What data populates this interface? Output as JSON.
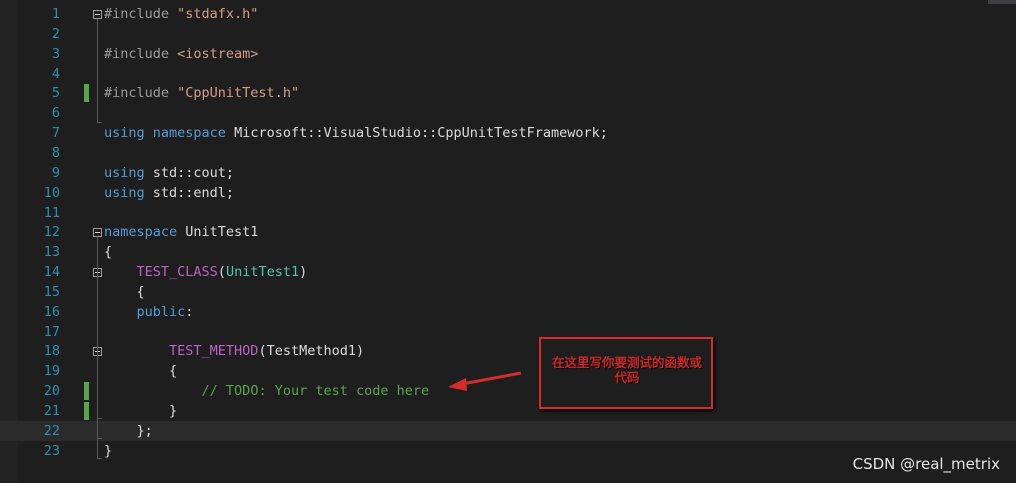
{
  "editor": {
    "lines": [
      {
        "number": "1",
        "fold": true,
        "changed": false,
        "tokens": [
          {
            "t": "#include ",
            "c": "pp"
          },
          {
            "t": "\"stdafx.h\"",
            "c": "str"
          }
        ]
      },
      {
        "number": "2",
        "fold": false,
        "changed": false,
        "tokens": []
      },
      {
        "number": "3",
        "fold": false,
        "changed": false,
        "tokens": [
          {
            "t": "#include ",
            "c": "pp"
          },
          {
            "t": "<iostream>",
            "c": "str"
          }
        ]
      },
      {
        "number": "4",
        "fold": false,
        "changed": false,
        "tokens": []
      },
      {
        "number": "5",
        "fold": false,
        "changed": true,
        "tokens": [
          {
            "t": "#include ",
            "c": "pp"
          },
          {
            "t": "\"CppUnitTest.h\"",
            "c": "str"
          }
        ]
      },
      {
        "number": "6",
        "fold": false,
        "changed": false,
        "tokens": []
      },
      {
        "number": "7",
        "fold": false,
        "changed": false,
        "tokens": [
          {
            "t": "using ",
            "c": "kw"
          },
          {
            "t": "namespace ",
            "c": "kw"
          },
          {
            "t": "Microsoft::VisualStudio::CppUnitTestFramework;",
            "c": "id"
          }
        ]
      },
      {
        "number": "8",
        "fold": false,
        "changed": false,
        "tokens": []
      },
      {
        "number": "9",
        "fold": false,
        "changed": false,
        "tokens": [
          {
            "t": "using ",
            "c": "kw"
          },
          {
            "t": "std::cout;",
            "c": "id"
          }
        ]
      },
      {
        "number": "10",
        "fold": false,
        "changed": false,
        "tokens": [
          {
            "t": "using ",
            "c": "kw"
          },
          {
            "t": "std::endl;",
            "c": "id"
          }
        ]
      },
      {
        "number": "11",
        "fold": false,
        "changed": false,
        "tokens": []
      },
      {
        "number": "12",
        "fold": true,
        "changed": false,
        "tokens": [
          {
            "t": "namespace ",
            "c": "kw"
          },
          {
            "t": "UnitTest1",
            "c": "id"
          }
        ]
      },
      {
        "number": "13",
        "fold": false,
        "changed": false,
        "tokens": [
          {
            "t": "{",
            "c": "id"
          }
        ]
      },
      {
        "number": "14",
        "fold": true,
        "changed": false,
        "tokens": [
          {
            "t": "    ",
            "c": "id"
          },
          {
            "t": "TEST_CLASS",
            "c": "mac"
          },
          {
            "t": "(",
            "c": "id"
          },
          {
            "t": "UnitTest1",
            "c": "typ"
          },
          {
            "t": ")",
            "c": "id"
          }
        ]
      },
      {
        "number": "15",
        "fold": false,
        "changed": false,
        "tokens": [
          {
            "t": "    {",
            "c": "id"
          }
        ]
      },
      {
        "number": "16",
        "fold": false,
        "changed": false,
        "tokens": [
          {
            "t": "    ",
            "c": "id"
          },
          {
            "t": "public",
            "c": "kw"
          },
          {
            "t": ":",
            "c": "id"
          }
        ]
      },
      {
        "number": "17",
        "fold": false,
        "changed": false,
        "tokens": []
      },
      {
        "number": "18",
        "fold": true,
        "changed": false,
        "tokens": [
          {
            "t": "        ",
            "c": "id"
          },
          {
            "t": "TEST_METHOD",
            "c": "mac"
          },
          {
            "t": "(TestMethod1)",
            "c": "id"
          }
        ]
      },
      {
        "number": "19",
        "fold": false,
        "changed": false,
        "tokens": [
          {
            "t": "        {",
            "c": "id"
          }
        ]
      },
      {
        "number": "20",
        "fold": false,
        "changed": true,
        "tokens": [
          {
            "t": "            ",
            "c": "id"
          },
          {
            "t": "// TODO: Your test code here",
            "c": "cmt"
          }
        ]
      },
      {
        "number": "21",
        "fold": false,
        "changed": true,
        "tokens": [
          {
            "t": "        }",
            "c": "id"
          }
        ]
      },
      {
        "number": "22",
        "fold": false,
        "changed": false,
        "current": true,
        "tokens": [
          {
            "t": "    };",
            "c": "id"
          }
        ]
      },
      {
        "number": "23",
        "fold": false,
        "changed": false,
        "tokens": [
          {
            "t": "}",
            "c": "id"
          }
        ]
      }
    ]
  },
  "annotation": {
    "text": "在这里写你要测试的函数或代码",
    "color": "#d42c2c"
  },
  "watermark": "CSDN @real_metrix"
}
